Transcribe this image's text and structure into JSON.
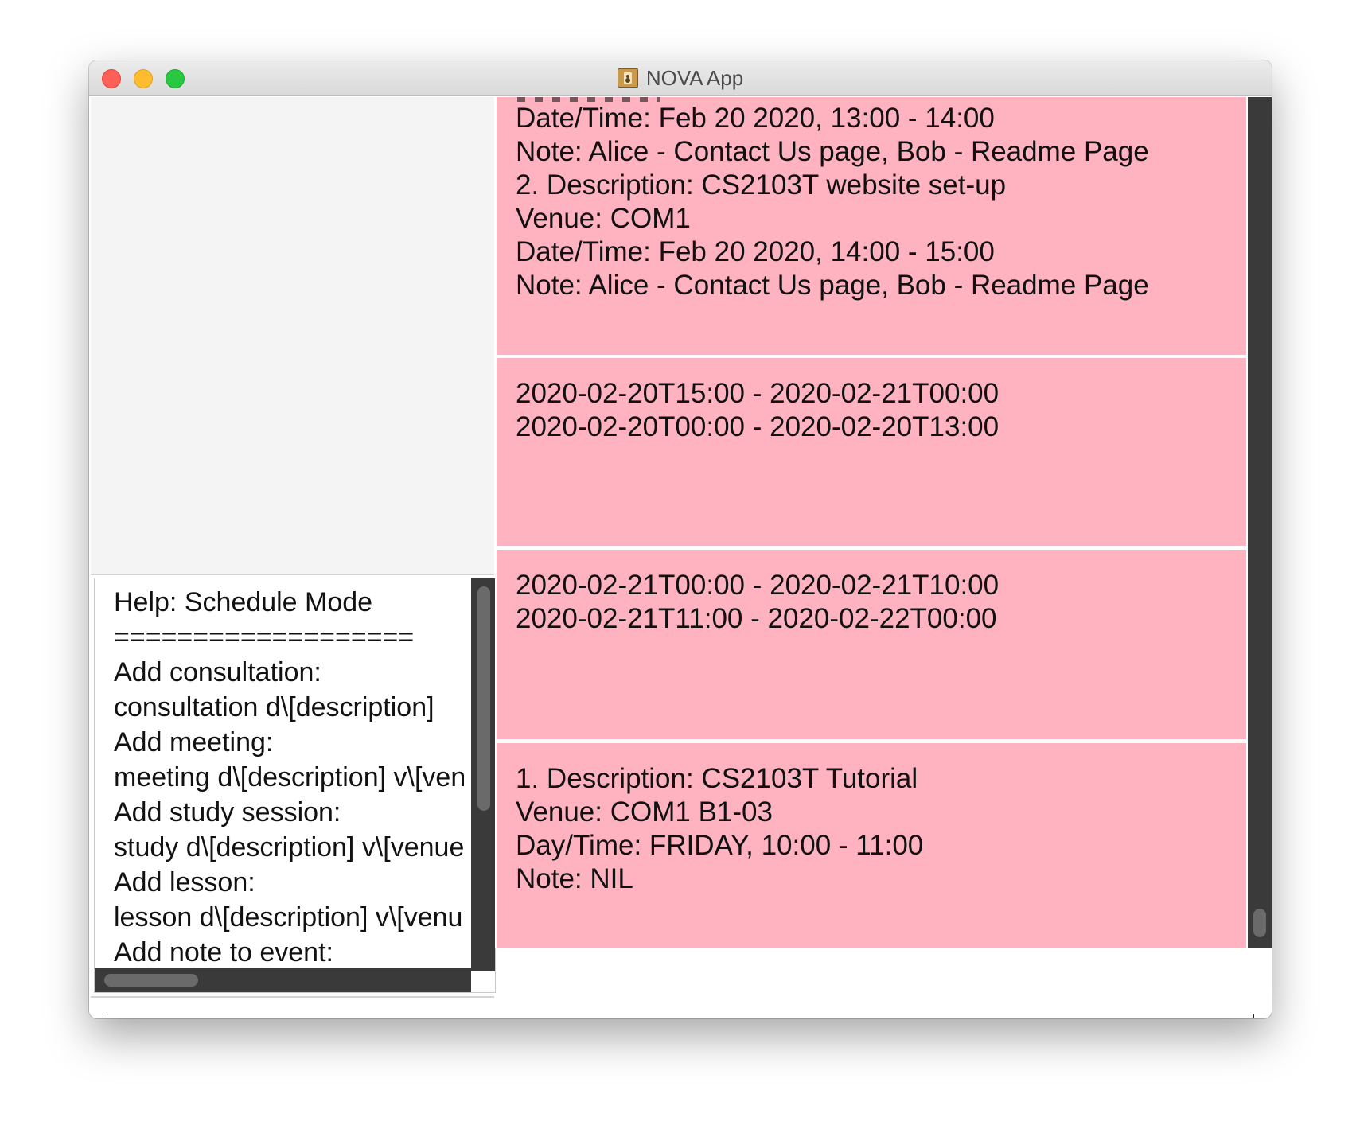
{
  "window": {
    "title": "NOVA App"
  },
  "help": {
    "lines": [
      "Help: Schedule Mode",
      "===================",
      "Add consultation:",
      "consultation d\\[description]",
      "Add meeting:",
      "meeting d\\[description] v\\[venue]",
      "Add study session:",
      "study d\\[description] v\\[venue]",
      "Add lesson:",
      "lesson d\\[description] v\\[venue]",
      "Add note to event:"
    ]
  },
  "events": [
    {
      "lines": [
        "Date/Time: Feb 20 2020, 13:00 - 14:00",
        "Note: Alice - Contact Us page, Bob - Readme Page",
        "2. Description: CS2103T website set-up",
        "Venue: COM1",
        "Date/Time: Feb 20 2020, 14:00 - 15:00",
        "Note: Alice - Contact Us page, Bob - Readme Page"
      ]
    },
    {
      "lines": [
        "2020-02-20T15:00 - 2020-02-21T00:00",
        "2020-02-20T00:00 - 2020-02-20T13:00"
      ]
    },
    {
      "lines": [
        "2020-02-21T00:00 - 2020-02-21T10:00",
        "2020-02-21T11:00 - 2020-02-22T00:00"
      ]
    },
    {
      "lines": [
        "1. Description: CS2103T Tutorial",
        "Venue: COM1 B1-03",
        "Day/Time: FRIDAY, 10:00 - 11:00",
        "Note: NIL"
      ]
    }
  ],
  "command": {
    "value": ""
  },
  "colors": {
    "card_background": "#ffb3c1",
    "scrollbar": "#3a3a3a",
    "close_button": "#fe5f57",
    "minimize_button": "#febc2e",
    "zoom_button": "#28c840"
  }
}
